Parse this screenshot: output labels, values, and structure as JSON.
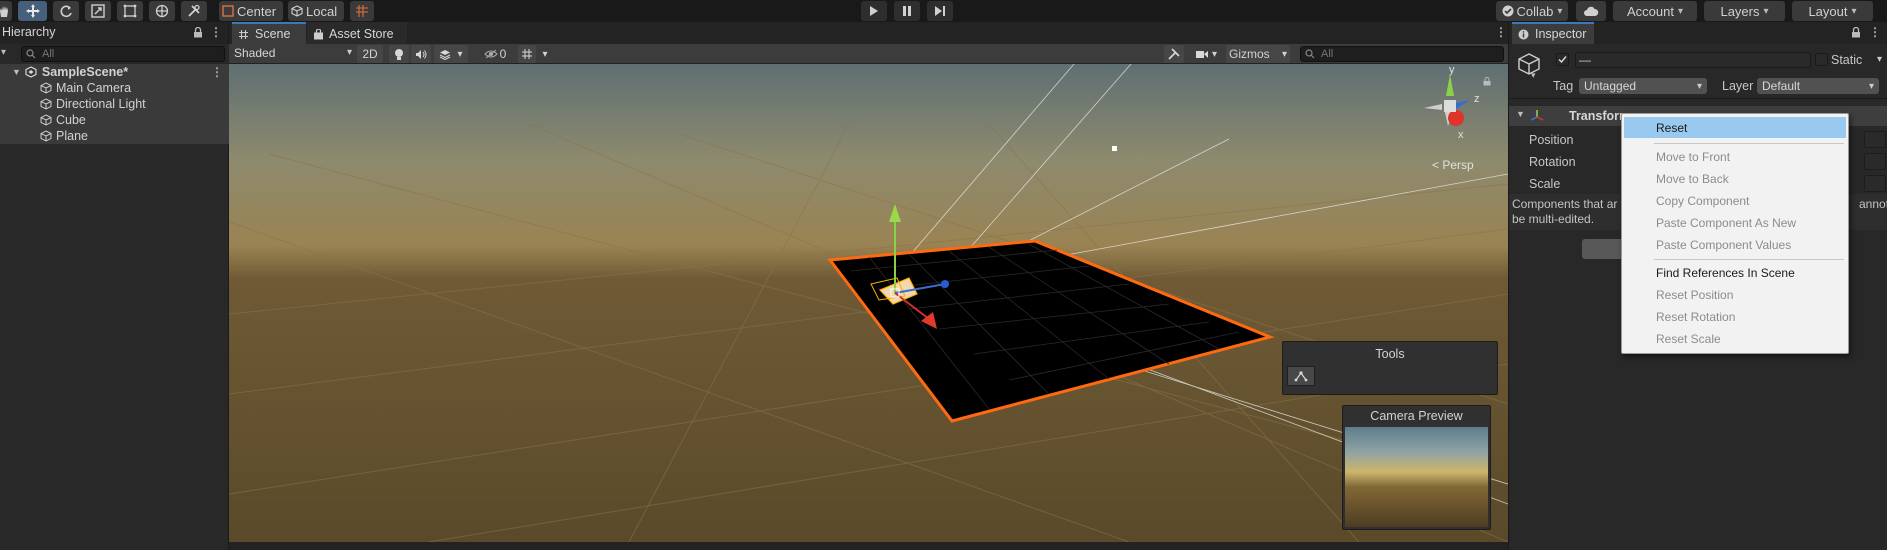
{
  "toolbar": {
    "pivot_label": "Center",
    "space_label": "Local",
    "collab_label": "Collab",
    "account_label": "Account",
    "layers_label": "Layers",
    "layout_label": "Layout"
  },
  "hierarchy": {
    "tab_label": "Hierarchy",
    "search_placeholder": "All",
    "scene_name": "SampleScene*",
    "items": [
      {
        "label": "Main Camera"
      },
      {
        "label": "Directional Light"
      },
      {
        "label": "Cube"
      },
      {
        "label": "Plane"
      }
    ]
  },
  "scene": {
    "tabs": [
      {
        "label": "Scene"
      },
      {
        "label": "Asset Store"
      }
    ],
    "shading_mode": "Shaded",
    "mode_2d_label": "2D",
    "hidden_count": "0",
    "gizmos_label": "Gizmos",
    "search_placeholder": "All",
    "persp_label": "Persp",
    "axis_labels": {
      "x": "x",
      "y": "y",
      "z": "z"
    },
    "tools_overlay_title": "Tools",
    "camera_preview_title": "Camera Preview"
  },
  "inspector": {
    "tab_label": "Inspector",
    "object_name": "—",
    "static_label": "Static",
    "tag_label": "Tag",
    "tag_value": "Untagged",
    "layer_label": "Layer",
    "layer_value": "Default",
    "component_title": "Transform",
    "position_label": "Position",
    "rotation_label": "Rotation",
    "scale_label": "Scale",
    "warning_line1": "Components that ar",
    "warning_line1_tail": "annot",
    "warning_line2": "be multi-edited."
  },
  "context_menu": {
    "items": [
      {
        "label": "Reset",
        "state": "highlight"
      },
      {
        "label": "Move to Front",
        "state": "disabled"
      },
      {
        "label": "Move to Back",
        "state": "disabled"
      },
      {
        "label": "Copy Component",
        "state": "disabled"
      },
      {
        "label": "Paste Component As New",
        "state": "disabled"
      },
      {
        "label": "Paste Component Values",
        "state": "disabled"
      },
      {
        "label": "Find References In Scene",
        "state": "enabled"
      },
      {
        "label": "Reset Position",
        "state": "disabled"
      },
      {
        "label": "Reset Rotation",
        "state": "disabled"
      },
      {
        "label": "Reset Scale",
        "state": "disabled"
      }
    ]
  },
  "colors": {
    "selection_outline": "#ff6a10",
    "active_tab_accent": "#3a79bb",
    "menu_highlight": "#99c9ef"
  }
}
